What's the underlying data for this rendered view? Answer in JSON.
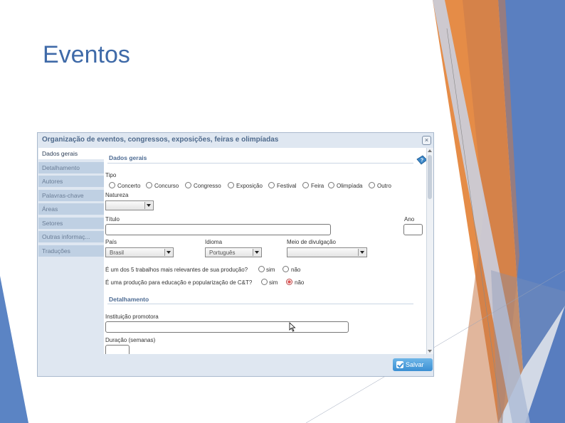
{
  "slide": {
    "title": "Eventos"
  },
  "dialog": {
    "title": "Organização de eventos, congressos, exposições, feiras e olimpíadas",
    "close_icon": "close-icon",
    "nav": [
      "Dados gerais",
      "Detalhamento",
      "Autores",
      "Palavras-chave",
      "Áreas",
      "Setores",
      "Outras informaç...",
      "Traduções"
    ],
    "active_nav": "Dados gerais",
    "section_general": "Dados gerais",
    "help_icon": "help-book-icon",
    "type_label": "Tipo",
    "types": [
      "Concerto",
      "Concurso",
      "Congresso",
      "Exposição",
      "Festival",
      "Feira",
      "Olimpíada",
      "Outro"
    ],
    "nature_label": "Natureza",
    "nature_value": "",
    "title_label": "Título",
    "title_value": "",
    "year_label": "Ano",
    "year_value": "",
    "country_label": "País",
    "country_value": "Brasil",
    "language_label": "Idioma",
    "language_value": "Português",
    "media_label": "Meio de divulgação",
    "media_value": "",
    "q1_text": "É um dos 5 trabalhos mais relevantes de sua produção?",
    "q2_text": "É uma produção para educação e popularização de C&T?",
    "yes_label": "sim",
    "no_label": "não",
    "q2_selected": "não",
    "section_detail": "Detalhamento",
    "institution_label": "Instituição promotora",
    "institution_value": "",
    "duration_label": "Duração (semanas)",
    "duration_value": "",
    "save_label": "Salvar",
    "colors": {
      "accent": "#3a8fd3",
      "section": "#4d6b93",
      "frame": "#dfe7f1"
    }
  }
}
